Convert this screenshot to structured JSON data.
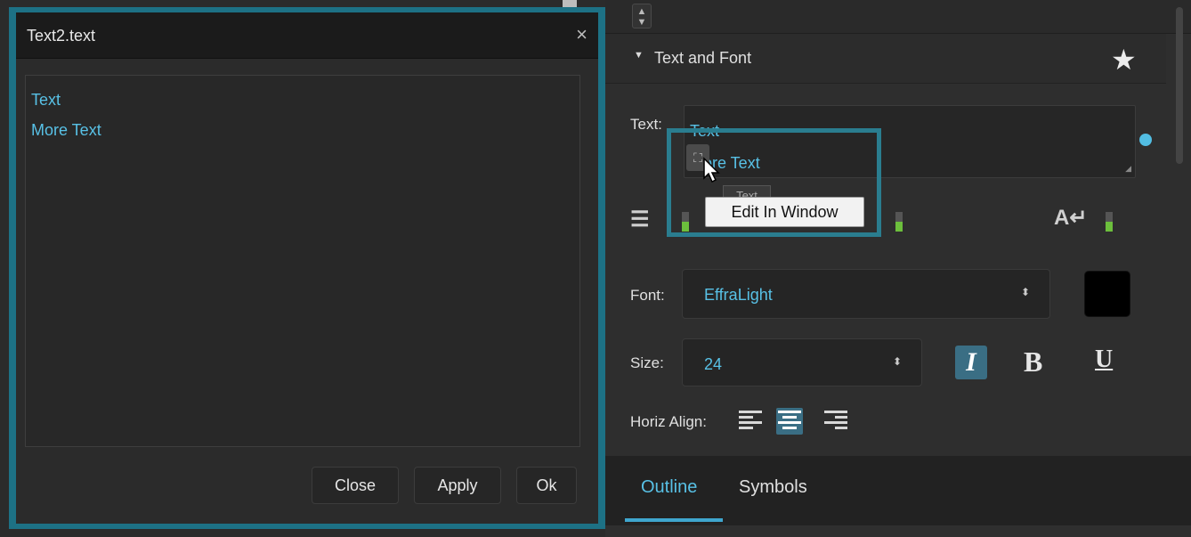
{
  "dialog": {
    "title": "Text2.text",
    "close_glyph": "×",
    "lines": [
      "Text",
      "More Text"
    ],
    "buttons": {
      "close": "Close",
      "apply": "Apply",
      "ok": "Ok"
    }
  },
  "inspector": {
    "section_title": "Text and Font",
    "text_label": "Text:",
    "text_lines": [
      "Text",
      "More Text"
    ],
    "font_label": "Font:",
    "font_value": "EffraLight",
    "size_label": "Size:",
    "size_value": "24",
    "horiz_align_label": "Horiz Align:",
    "tooltip": "Edit In Window",
    "tooltip_ghost": "Text",
    "font_color": "#000000"
  },
  "tabs": {
    "outline": "Outline",
    "symbols": "Symbols"
  },
  "icons": {
    "star": "star-icon",
    "wrap": "text-wrap-icon",
    "direction": "text-direction-icon",
    "edit_window": "edit-window-icon"
  },
  "colors": {
    "accent": "#58c1e6",
    "frame": "#1d7185",
    "active": "#3a6e84"
  }
}
